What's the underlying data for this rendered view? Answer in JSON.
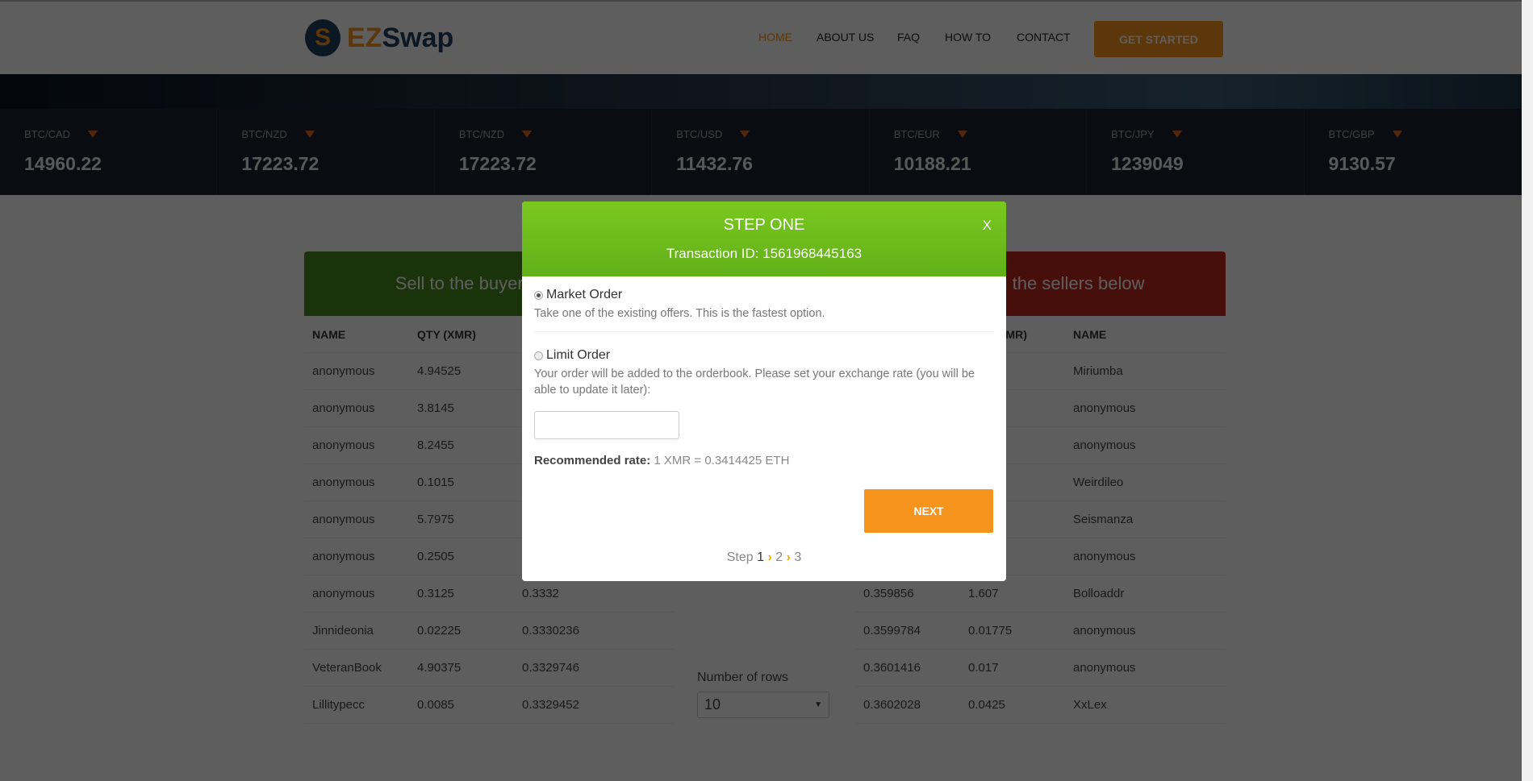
{
  "brand": {
    "logo_text_a": "EZ",
    "logo_text_b": "Swap",
    "mark": "S"
  },
  "nav": [
    {
      "label": "HOME",
      "active": true
    },
    {
      "label": "ABOUT US"
    },
    {
      "label": "FAQ"
    },
    {
      "label": "HOW TO"
    },
    {
      "label": "CONTACT"
    }
  ],
  "cta": "GET STARTED",
  "ticker": [
    {
      "pair": "BTC/CAD",
      "value": "14960.22"
    },
    {
      "pair": "BTC/NZD",
      "value": "17223.72"
    },
    {
      "pair": "BTC/NZD",
      "value": "17223.72"
    },
    {
      "pair": "BTC/USD",
      "value": "11432.76"
    },
    {
      "pair": "BTC/EUR",
      "value": "10188.21"
    },
    {
      "pair": "BTC/JPY",
      "value": "1239049"
    },
    {
      "pair": "BTC/GBP",
      "value": "9130.57"
    }
  ],
  "sell": {
    "title": "Sell to the buyers below",
    "color": "#4a8a1a",
    "headers": [
      "NAME",
      "QTY (XMR)",
      ""
    ],
    "rows": [
      [
        "anonymous",
        "4.94525",
        ""
      ],
      [
        "anonymous",
        "3.8145",
        ""
      ],
      [
        "anonymous",
        "8.2455",
        ""
      ],
      [
        "anonymous",
        "0.1015",
        ""
      ],
      [
        "anonymous",
        "5.7975",
        ""
      ],
      [
        "anonymous",
        "0.2505",
        ""
      ],
      [
        "anonymous",
        "0.3125",
        "0.3332"
      ],
      [
        "Jinnideonia",
        "0.02225",
        "0.3330236"
      ],
      [
        "VeteranBook",
        "4.90375",
        "0.3329746"
      ],
      [
        "Lillitypecc",
        "0.0085",
        "0.3329452"
      ]
    ]
  },
  "buy": {
    "title": "Buy from the sellers below",
    "color": "#c0281e",
    "headers": [
      "",
      "QTY (XMR)",
      "NAME"
    ],
    "rows": [
      [
        "",
        "",
        "Miriumba"
      ],
      [
        "",
        "",
        "anonymous"
      ],
      [
        "",
        "",
        "anonymous"
      ],
      [
        "",
        "",
        "Weirdileo"
      ],
      [
        "",
        "",
        "Seismanza"
      ],
      [
        "",
        "",
        "anonymous"
      ],
      [
        "0.359856",
        "1.607",
        "Bolloaddr"
      ],
      [
        "0.3599784",
        "0.01775",
        "anonymous"
      ],
      [
        "0.3601416",
        "0.017",
        "anonymous"
      ],
      [
        "0.3602028",
        "0.0425",
        "XxLex"
      ]
    ]
  },
  "rows_selector": {
    "label": "Number of rows",
    "value": "10"
  },
  "modal": {
    "title": "STEP ONE",
    "transaction": "Transaction ID: 1561968445163",
    "close": "X",
    "market": {
      "label": "Market Order",
      "desc": "Take one of the existing offers. This is the fastest option.",
      "selected": true
    },
    "limit": {
      "label": "Limit Order",
      "desc": "Your order will be added to the orderbook. Please set your exchange rate (you will be able to update it later):",
      "selected": false
    },
    "rate_input": "",
    "rec_label": "Recommended rate:",
    "rec_value": " 1 XMR = 0.3414425 ETH",
    "next": "NEXT",
    "steps": {
      "prefix": "Step ",
      "s1": "1",
      "s2": "2",
      "s3": "3"
    }
  }
}
